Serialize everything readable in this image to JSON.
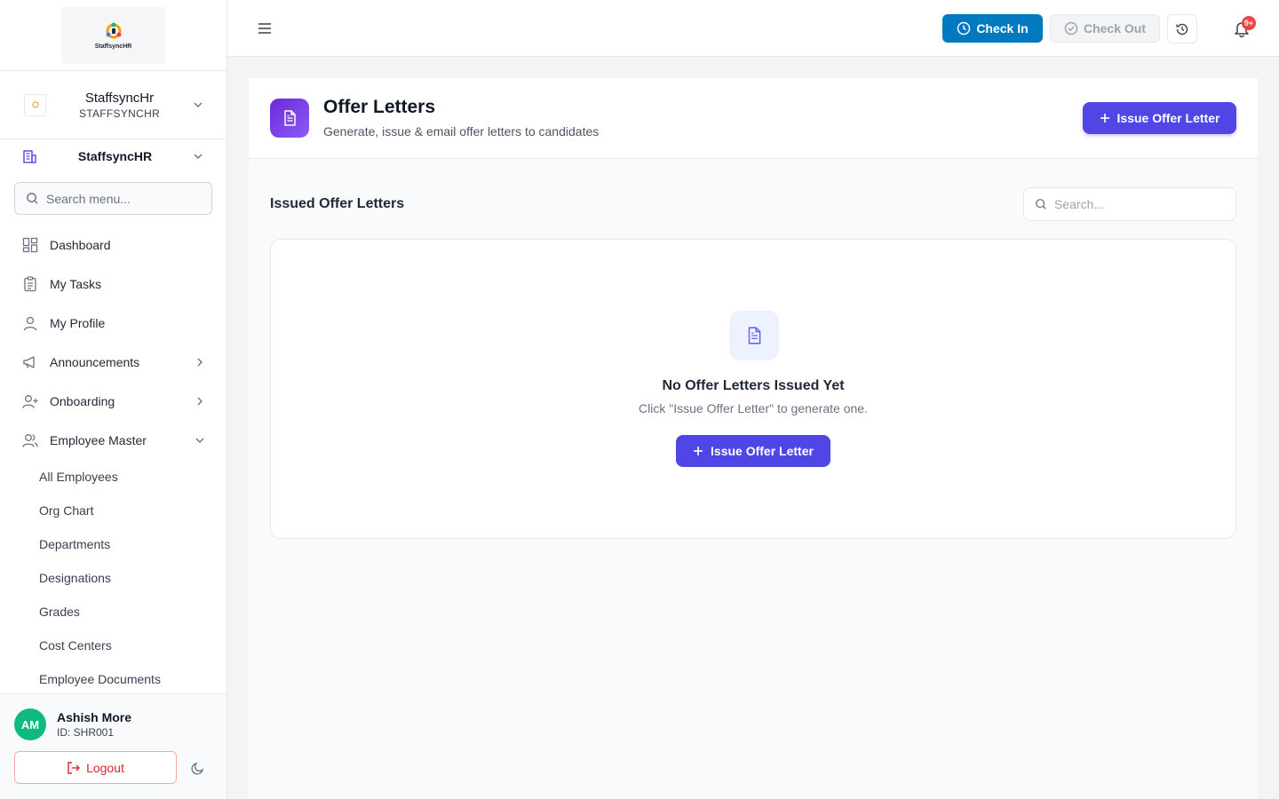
{
  "brand": {
    "logo_text": "StaffsyncHR"
  },
  "org": {
    "name": "StaffsyncHr",
    "code": "STAFFSYNCHR",
    "thumb": "logo"
  },
  "company": {
    "name": "StaffsyncHR"
  },
  "menu_search": {
    "placeholder": "Search menu..."
  },
  "nav": {
    "items": [
      {
        "label": "Dashboard",
        "icon": "dashboard-grid-icon"
      },
      {
        "label": "My Tasks",
        "icon": "clipboard-icon"
      },
      {
        "label": "My Profile",
        "icon": "user-icon"
      },
      {
        "label": "Announcements",
        "icon": "megaphone-icon"
      },
      {
        "label": "Onboarding",
        "icon": "user-plus-icon"
      },
      {
        "label": "Employee Master",
        "icon": "users-icon"
      }
    ],
    "sub_items": [
      "All Employees",
      "Org Chart",
      "Departments",
      "Designations",
      "Grades",
      "Cost Centers",
      "Employee Documents"
    ]
  },
  "user": {
    "initials": "AM",
    "name": "Ashish More",
    "id_text": "ID: SHR001"
  },
  "logout_label": "Logout",
  "topbar": {
    "check_in": "Check In",
    "check_out": "Check Out",
    "notif_badge": "9+"
  },
  "page": {
    "title": "Offer Letters",
    "subtitle": "Generate, issue & email offer letters to candidates",
    "issue_button": "Issue Offer Letter"
  },
  "list": {
    "title": "Issued Offer Letters",
    "search_placeholder": "Search...",
    "empty_title": "No Offer Letters Issued Yet",
    "empty_sub": "Click \"Issue Offer Letter\" to generate one.",
    "empty_button": "Issue Offer Letter"
  },
  "colors": {
    "primary": "#4f46e5",
    "check_in": "#0079c1",
    "avatar": "#10b981",
    "danger": "#dc2626"
  }
}
